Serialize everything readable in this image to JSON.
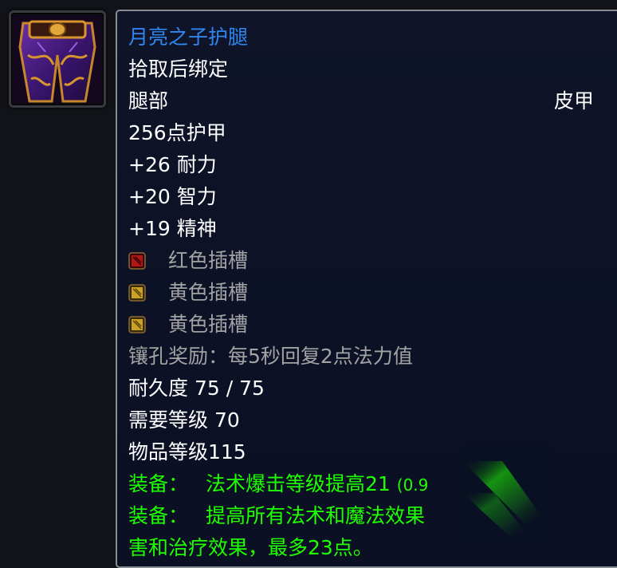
{
  "item": {
    "name": "月亮之子护腿",
    "binding": "拾取后绑定",
    "slot": "腿部",
    "armor_type": "皮甲",
    "armor": "256点护甲",
    "stats": [
      "+26 耐力",
      "+20 智力",
      "+19 精神"
    ],
    "sockets": [
      {
        "label": "红色插槽",
        "color": "#b01818",
        "icon": "red-socket-icon"
      },
      {
        "label": "黄色插槽",
        "color": "#c9a227",
        "icon": "yellow-socket-icon"
      },
      {
        "label": "黄色插槽",
        "color": "#c9a227",
        "icon": "yellow-socket-icon"
      }
    ],
    "socket_bonus": "镶孔奖励：每5秒回复2点法力值",
    "durability": "耐久度 75 / 75",
    "required_level": "需要等级 70",
    "item_level": "物品等级115",
    "equip_effects": [
      {
        "prefix": "装备：",
        "text": "法术爆击等级提高21",
        "extra": "(0.9"
      },
      {
        "prefix": "装备：",
        "text": "提高所有法术和魔法效果"
      }
    ],
    "equip_continuation": "害和治疗效果，最多23点。"
  },
  "colors": {
    "name": "#2f86ef",
    "white": "#ffffff",
    "gray": "#a3a3a3",
    "green": "#1eff00",
    "background": "#0c1126"
  },
  "icon": "purple-leather-leggings-icon"
}
